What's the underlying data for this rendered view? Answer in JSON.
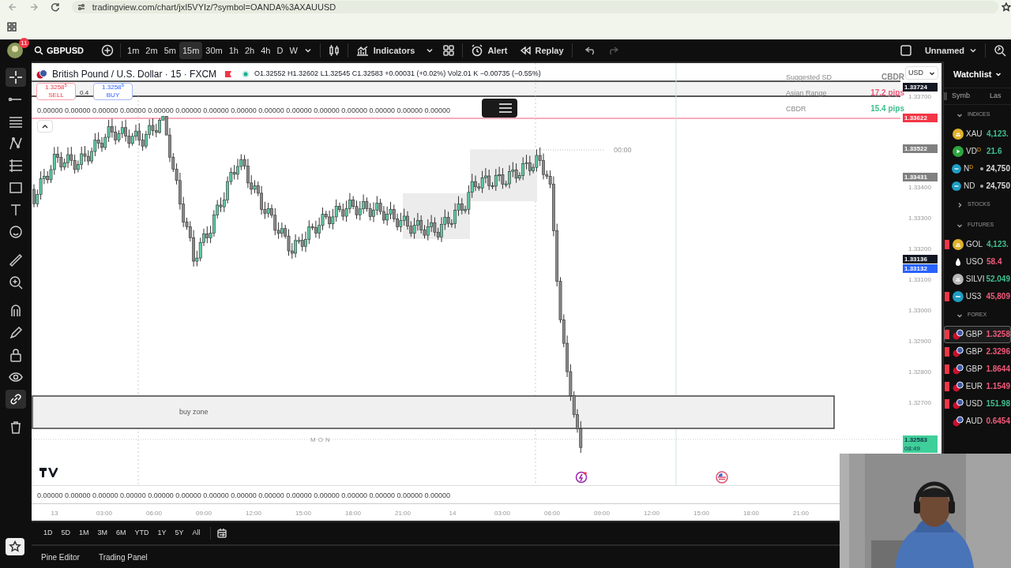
{
  "browser": {
    "url": "tradingview.com/chart/jxI5VYIz/?symbol=OANDA%3AXAUUSD"
  },
  "toolbar": {
    "notification_count": "11",
    "symbol": "GBPUSD",
    "timeframes": [
      {
        "label": "1m",
        "selected": false
      },
      {
        "label": "2m",
        "selected": false
      },
      {
        "label": "5m",
        "selected": false
      },
      {
        "label": "15m",
        "selected": true
      },
      {
        "label": "30m",
        "selected": false
      },
      {
        "label": "1h",
        "selected": false
      },
      {
        "label": "2h",
        "selected": false
      },
      {
        "label": "4h",
        "selected": false
      },
      {
        "label": "D",
        "selected": false
      },
      {
        "label": "W",
        "selected": false
      }
    ],
    "indicators": "Indicators",
    "alert": "Alert",
    "replay": "Replay",
    "layout_name": "Unnamed"
  },
  "tools": [
    {
      "kind": "crosshair",
      "selected": true
    },
    {
      "kind": "line",
      "selected": false
    },
    {
      "kind": "hlines",
      "selected": false
    },
    {
      "kind": "pattern",
      "selected": false
    },
    {
      "kind": "fib",
      "selected": false
    },
    {
      "kind": "rect",
      "selected": false
    },
    {
      "kind": "text",
      "selected": false
    },
    {
      "kind": "smile",
      "selected": false
    },
    {
      "kind": "ruler",
      "selected": false
    },
    {
      "kind": "zoom",
      "selected": false
    },
    {
      "kind": "magnet",
      "selected": false
    },
    {
      "kind": "pencil",
      "selected": false
    },
    {
      "kind": "lock",
      "selected": false
    },
    {
      "kind": "eye",
      "selected": false
    },
    {
      "kind": "link",
      "selected": true
    },
    {
      "kind": "trash",
      "selected": false
    }
  ],
  "chart": {
    "title": "British Pound / U.S. Dollar · 15 · FXCM",
    "ohlc": "O1.32552 H1.32602 L1.32545 C1.32583 +0.00031 (+0.02%) Vol2.01 K −0.00735 (−0.55%)",
    "sell": {
      "price": "1.3258$^{5}$",
      "label": "SELL"
    },
    "spread": "0.4",
    "buy": {
      "price": "1.3258$^{9}$",
      "label": "BUY"
    },
    "indicator_values_top": "0.00000 0.00000 0.00000 0.00000 0.00000 0.00000 0.00000 0.00000 0.00000 0.00000 0.00000 0.00000 0.00000 0.00000 0.00000",
    "indicator_values_bottom": "0.00000 0.00000 0.00000 0.00000 0.00000 0.00000 0.00000 0.00000 0.00000 0.00000 0.00000 0.00000 0.00000 0.00000 0.00000",
    "currency": "USD",
    "info_table": [
      {
        "label": "Suggested SD",
        "value": "CBDR",
        "color": "#888888"
      },
      {
        "label": "Asian Range",
        "value": "17.2 pips",
        "color": "#f05a7a"
      },
      {
        "label": "CBDR",
        "value": "15.4 pips",
        "color": "#3fbf8f"
      }
    ],
    "session_time": "00:00",
    "zone_label": "buy zone",
    "day_label": "MON",
    "price_axis": [
      "1.33700",
      "1.33400",
      "1.33300",
      "1.33200",
      "1.33100",
      "1.33000",
      "1.32900",
      "1.32800",
      "1.32700"
    ],
    "price_badges": [
      {
        "text": "1.33724",
        "kind": "dark"
      },
      {
        "text": "1.33622",
        "kind": "red"
      },
      {
        "text": "1.33522",
        "kind": "gray"
      },
      {
        "text": "1.33431",
        "kind": "gray"
      },
      {
        "text": "1.33136",
        "kind": "dark"
      },
      {
        "text": "1.33132",
        "kind": "blue"
      },
      {
        "text": "1.32583",
        "sub": "08:49",
        "kind": "green"
      }
    ],
    "time_axis": [
      "13",
      "03:00",
      "06:00",
      "09:00",
      "12:00",
      "15:00",
      "18:00",
      "21:00",
      "14",
      "03:00",
      "06:00",
      "09:00",
      "12:00",
      "15:00",
      "18:00",
      "21:00"
    ]
  },
  "ranges": [
    "1D",
    "5D",
    "1M",
    "3M",
    "6M",
    "YTD",
    "1Y",
    "5Y",
    "All"
  ],
  "bottom_tabs": [
    "Pine Editor",
    "Trading Panel"
  ],
  "watchlist": {
    "title": "Watchlist",
    "columns": [
      "Symb",
      "Las"
    ],
    "sections": [
      {
        "name": "INDICES",
        "expanded": true,
        "items": [
          {
            "symbol": "XAU",
            "price": "4,123.",
            "color": "#3fbf8f",
            "kind": "gold",
            "flagged": false,
            "selected": false,
            "dot": false
          },
          {
            "symbol": "VD$^{D}$",
            "price": "21.6",
            "color": "#3fbf8f",
            "kind": "play",
            "flagged": false,
            "selected": false,
            "dot": false
          },
          {
            "symbol": "N$^{D}$",
            "price": "24,750",
            "color": "#dddddd",
            "kind": "index",
            "flagged": false,
            "selected": false,
            "dot": true
          },
          {
            "symbol": "ND",
            "price": "24,750",
            "color": "#dddddd",
            "kind": "index",
            "flagged": false,
            "selected": false,
            "dot": true
          }
        ]
      },
      {
        "name": "STOCKS",
        "expanded": false
      },
      {
        "name": "FUTURES",
        "expanded": true,
        "items": [
          {
            "symbol": "GOL",
            "price": "4,123.",
            "color": "#3fbf8f",
            "kind": "gold",
            "flagged": true,
            "selected": false,
            "dot": false
          },
          {
            "symbol": "USO",
            "price": "58.4",
            "color": "#f05a7a",
            "kind": "drop",
            "flagged": false,
            "selected": false,
            "dot": false
          },
          {
            "symbol": "SILVI",
            "price": "52.049",
            "color": "#3fbf8f",
            "kind": "silver",
            "flagged": false,
            "selected": false,
            "dot": false
          },
          {
            "symbol": "US3",
            "price": "45,809",
            "color": "#f05a7a",
            "kind": "index",
            "flagged": true,
            "selected": false,
            "dot": false
          }
        ]
      },
      {
        "name": "FOREX",
        "expanded": true,
        "items": [
          {
            "symbol": "GBP",
            "price": "1.3258",
            "color": "#f05a7a",
            "kind": "pair",
            "flagged": true,
            "selected": true,
            "dot": false
          },
          {
            "symbol": "GBP",
            "price": "2.3296",
            "color": "#f05a7a",
            "kind": "pair",
            "flagged": true,
            "selected": false,
            "dot": false
          },
          {
            "symbol": "GBP",
            "price": "1.8644",
            "color": "#f05a7a",
            "kind": "pair",
            "flagged": true,
            "selected": false,
            "dot": false
          },
          {
            "symbol": "EUR",
            "price": "1.1549",
            "color": "#f05a7a",
            "kind": "pair",
            "flagged": true,
            "selected": false,
            "dot": false
          },
          {
            "symbol": "USD",
            "price": "151.98",
            "color": "#3fbf8f",
            "kind": "pair",
            "flagged": true,
            "selected": false,
            "dot": false
          },
          {
            "symbol": "AUD",
            "price": "0.6454",
            "color": "#f05a7a",
            "kind": "pair",
            "flagged": false,
            "selected": false,
            "dot": false
          }
        ]
      }
    ]
  },
  "webcam": {
    "kind": "picture"
  }
}
